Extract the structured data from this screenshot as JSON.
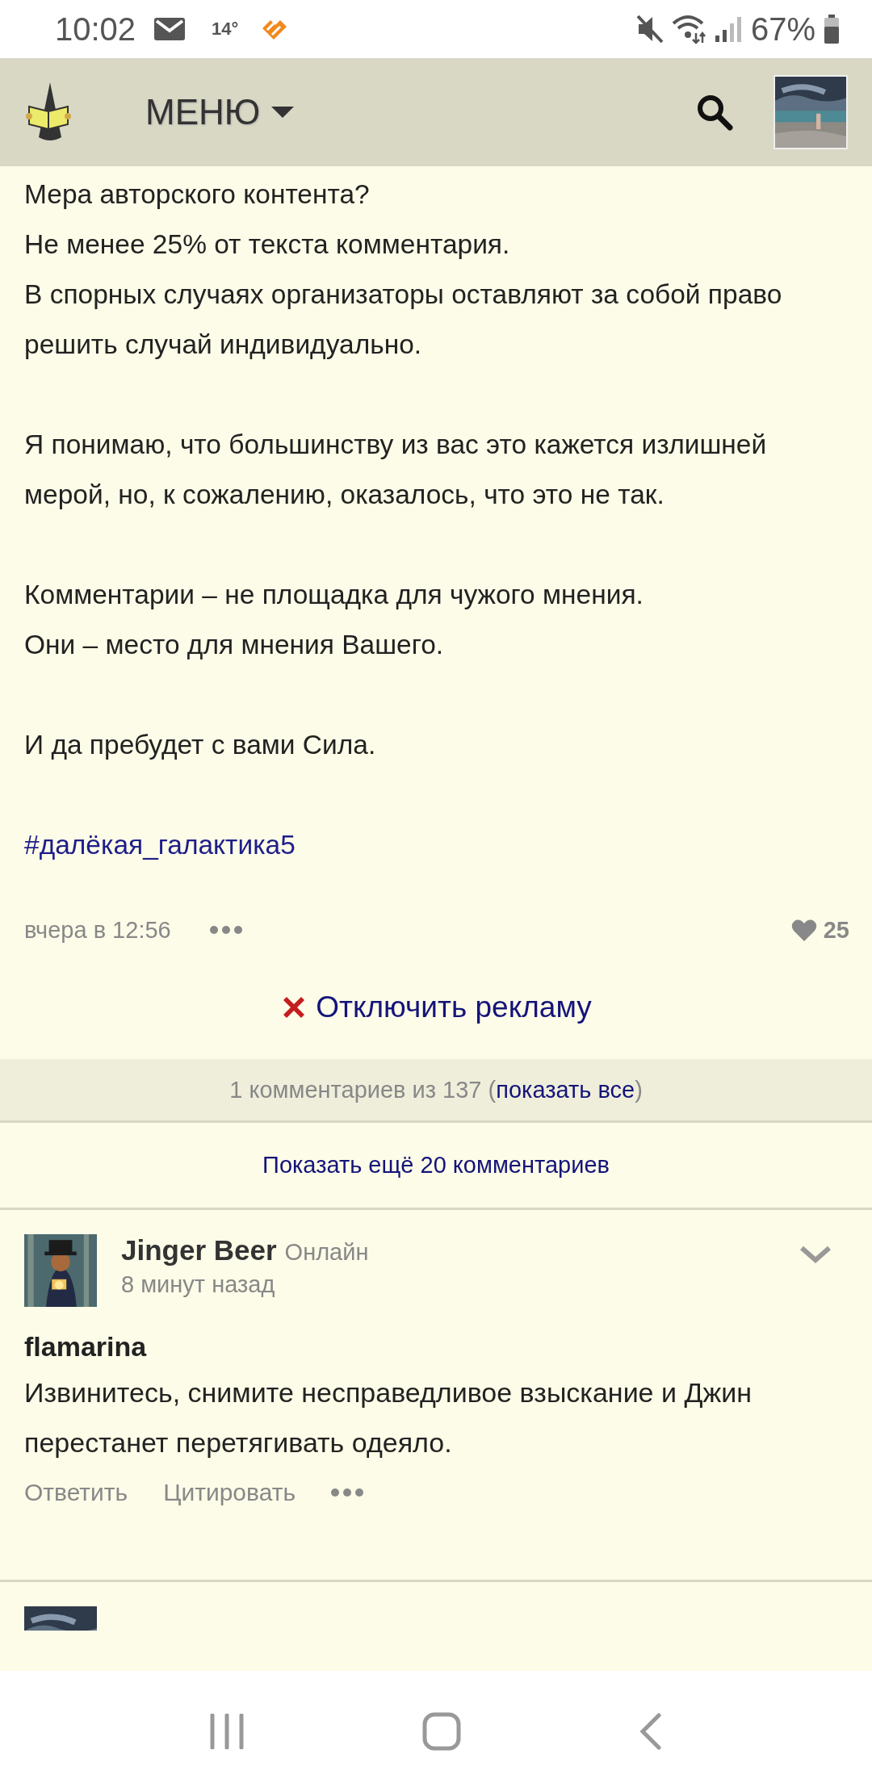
{
  "status_bar": {
    "time": "10:02",
    "temperature": "14°",
    "battery": "67%"
  },
  "header": {
    "menu_label": "МЕНЮ"
  },
  "post": {
    "paragraphs": [
      {
        "lines": [
          "Мера авторского контента?",
          "Не менее 25% от текста комментария.",
          "В спорных случаях организаторы оставляют за собой право решить случай индивидуально."
        ]
      },
      {
        "lines": [
          "Я понимаю, что большинству из вас это кажется излишней мерой, но, к сожалению, оказалось, что это не так."
        ]
      },
      {
        "lines": [
          "Комментарии – не площадка для чужого мнения.",
          "Они – место для мнения Вашего."
        ]
      },
      {
        "lines": [
          "И да пребудет с вами Сила."
        ]
      }
    ],
    "hashtag": "#далёкая_галактика5",
    "timestamp": "вчера в 12:56",
    "likes": "25"
  },
  "ad_link": "Отключить рекламу",
  "comments_bar": {
    "summary": "1 комментариев из 137 (",
    "show_all": "показать все",
    "close": ")"
  },
  "show_more": "Показать ещё 20 комментариев",
  "comments": [
    {
      "author": "Jinger Beer",
      "status": "Онлайн",
      "time": "8 минут назад",
      "quote_author": "flamarina",
      "text": "Извинитесь, снимите несправедливое взыскание и Джин перестанет перетягивать одеяло.",
      "actions": [
        "Ответить",
        "Цитировать"
      ]
    }
  ]
}
